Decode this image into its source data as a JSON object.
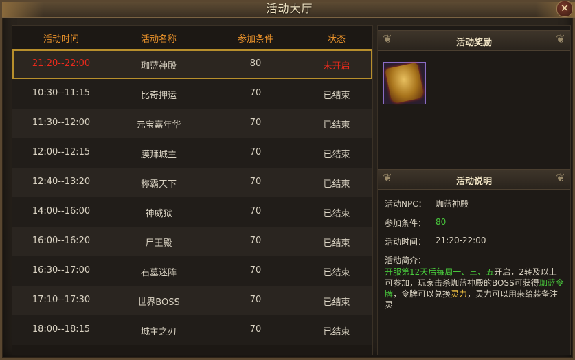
{
  "window": {
    "title": "活动大厅",
    "close": "✕"
  },
  "table": {
    "headers": [
      "活动时间",
      "活动名称",
      "参加条件",
      "状态"
    ],
    "rows": [
      {
        "time": "21:20--22:00",
        "name": "珈蓝神殿",
        "level": "80",
        "status": "未开启"
      },
      {
        "time": "10:30--11:15",
        "name": "比奇押运",
        "level": "70",
        "status": "已结束"
      },
      {
        "time": "11:30--12:00",
        "name": "元宝嘉年华",
        "level": "70",
        "status": "已结束"
      },
      {
        "time": "12:00--12:15",
        "name": "膜拜城主",
        "level": "70",
        "status": "已结束"
      },
      {
        "time": "12:40--13:20",
        "name": "称霸天下",
        "level": "70",
        "status": "已结束"
      },
      {
        "time": "14:00--16:00",
        "name": "神威狱",
        "level": "70",
        "status": "已结束"
      },
      {
        "time": "16:00--16:20",
        "name": "尸王殿",
        "level": "70",
        "status": "已结束"
      },
      {
        "time": "16:30--17:00",
        "name": "石墓迷阵",
        "level": "70",
        "status": "已结束"
      },
      {
        "time": "17:10--17:30",
        "name": "世界BOSS",
        "level": "70",
        "status": "已结束"
      },
      {
        "time": "18:00--18:15",
        "name": "城主之刃",
        "level": "70",
        "status": "已结束"
      }
    ]
  },
  "reward": {
    "heading": "活动奖励",
    "item_icon": "gold-token-icon"
  },
  "details": {
    "heading": "活动说明",
    "npc_label": "活动NPC：",
    "npc_value": "珈蓝神殿",
    "cond_label": "参加条件：",
    "cond_value": "80",
    "time_label": "活动时间：",
    "time_value": "21:20-22:00",
    "intro_label": "活动简介：",
    "intro_p1": "开服第12天后每周一、三、五",
    "intro_p2": "开启，2转及以上可参加，玩家击杀珈蓝神殿的BOSS可获得",
    "intro_p3": "珈蓝令牌",
    "intro_p4": "，令牌可以兑换",
    "intro_p5": "灵力",
    "intro_p6": "，灵力可以用来给装备注灵"
  }
}
